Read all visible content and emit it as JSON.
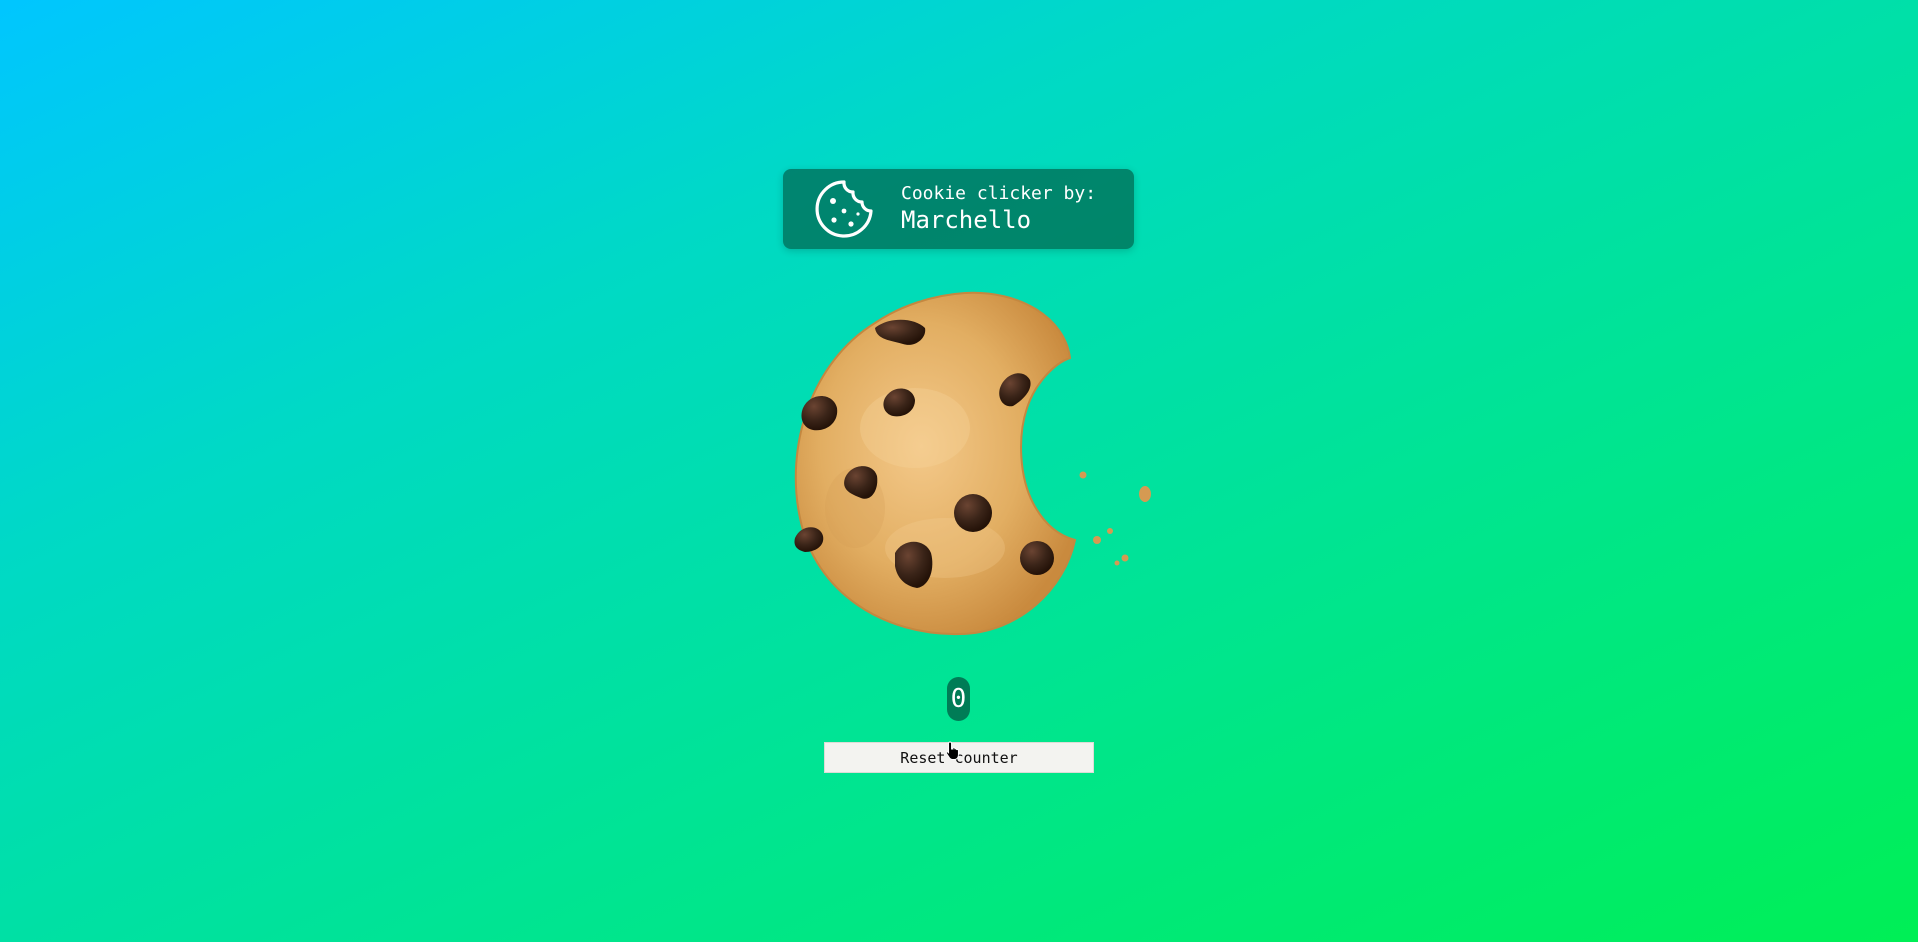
{
  "header": {
    "line1": "Cookie clicker by:",
    "line2": "Marchello",
    "icon": "cookie-icon"
  },
  "cookie": {
    "icon": "bitten-chocolate-chip-cookie"
  },
  "counter": {
    "value": "0"
  },
  "reset_button": {
    "label": "Reset counter"
  },
  "colors": {
    "gradient_start": "#00c6ff",
    "gradient_end": "#00ef55",
    "card_bg": "#0a5a46",
    "cookie_dough": "#e2ae62",
    "chocolate_chip": "#3a2418"
  }
}
